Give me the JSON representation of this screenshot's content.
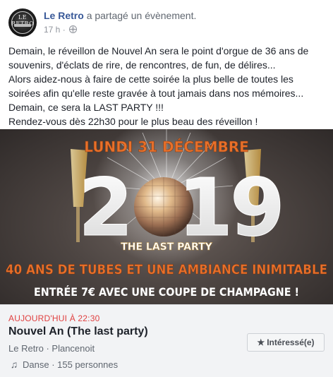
{
  "header": {
    "page_name": "Le Retro",
    "action_text": "a partagé un évènement.",
    "time": "17 h",
    "separator": "·",
    "avatar_text": "LE RETRO",
    "privacy_icon": "globe-icon"
  },
  "post": {
    "lines": [
      "Demain, le réveillon de Nouvel An sera le point d'orgue de 36 ans de",
      "souvenirs, d'éclats de rire, de rencontres, de fun, de délires...",
      "Alors aidez-nous à faire de cette soirée la plus belle de toutes les",
      "soirées afin qu'elle reste gravée à tout jamais dans nos mémoires...",
      "Demain, ce sera la LAST PARTY !!!",
      "Rendez-vous dès 22h30 pour le plus beau des réveillon !"
    ]
  },
  "poster": {
    "date_text": "LUNDI 31 DÉCEMBRE",
    "year_left": "2",
    "year_right": "19",
    "subtitle": "THE LAST PARTY",
    "tagline": "40 ANS DE TUBES ET UNE AMBIANCE INIMITABLE",
    "price_text": "ENTRÉE 7€  AVEC UNE COUPE DE CHAMPAGNE !",
    "accent_color": "#e8702a",
    "gold_color": "#d9a64a"
  },
  "event": {
    "date_label": "AUJOURD'HUI À 22:30",
    "title": "Nouvel An (The last party)",
    "location": "Le Retro · Plancenoit",
    "details": "Danse · 155 personnes",
    "interest_label": "Intéressé(e)",
    "details_icon": "music-note-icon",
    "interest_icon": "star-icon"
  }
}
